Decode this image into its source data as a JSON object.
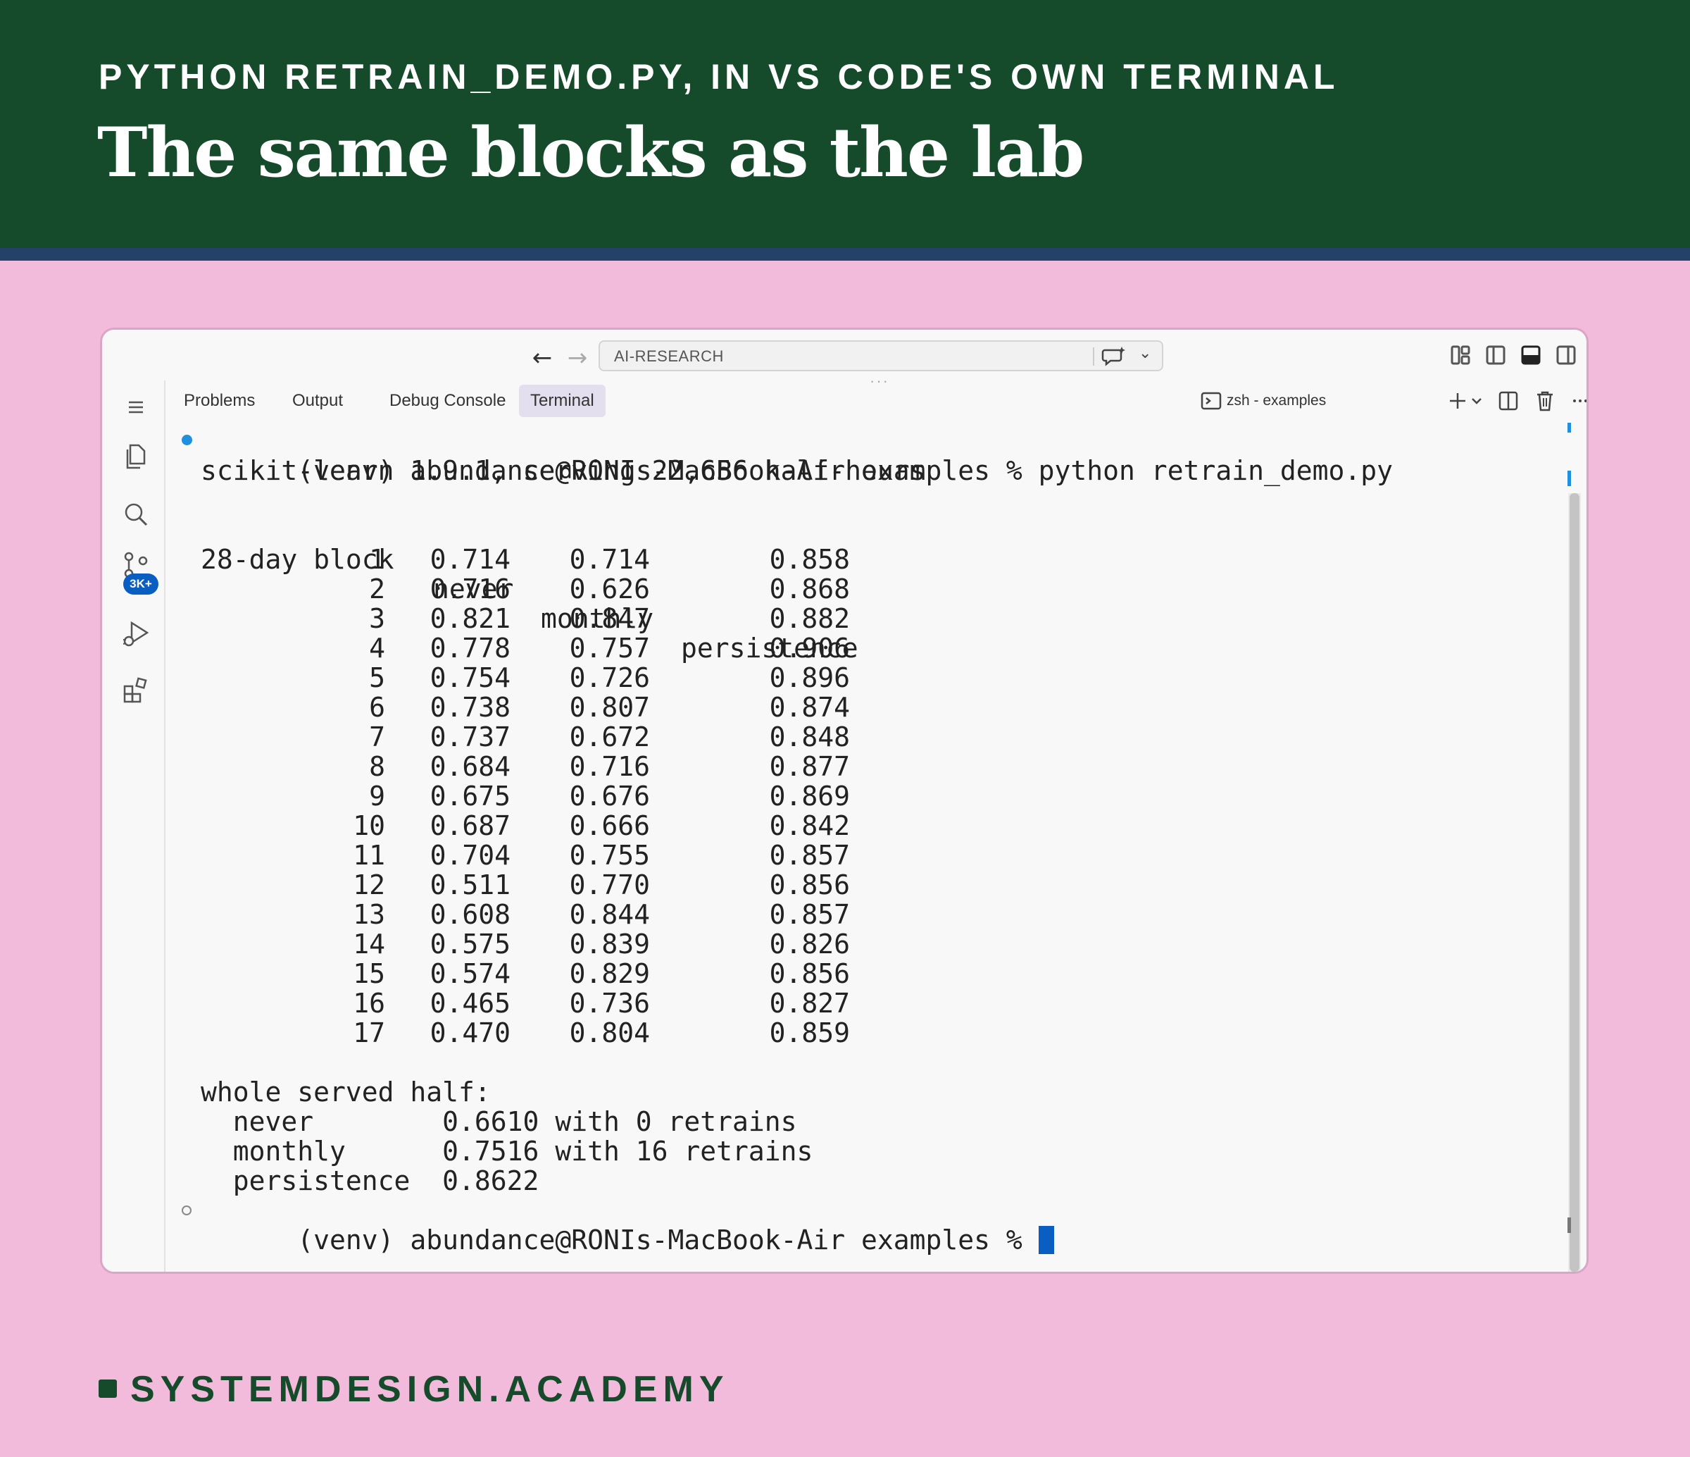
{
  "header": {
    "kicker": "PYTHON RETRAIN_DEMO.PY, IN VS CODE'S OWN TERMINAL",
    "title": "The same blocks as the lab"
  },
  "window": {
    "search_text": "AI-RESEARCH",
    "activity_bar": {
      "icons": [
        "menu-icon",
        "explorer-icon",
        "search-icon",
        "source-control-icon",
        "run-debug-icon",
        "extensions-icon"
      ],
      "source_control_badge": "3K+"
    },
    "panel_tabs": {
      "problems": "Problems",
      "output": "Output",
      "debug_console": "Debug Console",
      "terminal": "Terminal",
      "active": "Terminal"
    },
    "terminal_name": "zsh - examples",
    "accent_color": "#0a5ec2"
  },
  "terminal": {
    "command_line": "(venv) abundance@RONIs-MacBook-Air examples % python retrain_demo.py",
    "info_line": "scikit-learn 1.9.1, serving 22,656 half-hours",
    "table_header": {
      "block": "28-day block",
      "never": "never",
      "monthly": "monthly",
      "persistence": "persistence"
    },
    "rows": [
      {
        "block": "1",
        "never": "0.714",
        "monthly": "0.714",
        "persistence": "0.858"
      },
      {
        "block": "2",
        "never": "0.716",
        "monthly": "0.626",
        "persistence": "0.868"
      },
      {
        "block": "3",
        "never": "0.821",
        "monthly": "0.847",
        "persistence": "0.882"
      },
      {
        "block": "4",
        "never": "0.778",
        "monthly": "0.757",
        "persistence": "0.906"
      },
      {
        "block": "5",
        "never": "0.754",
        "monthly": "0.726",
        "persistence": "0.896"
      },
      {
        "block": "6",
        "never": "0.738",
        "monthly": "0.807",
        "persistence": "0.874"
      },
      {
        "block": "7",
        "never": "0.737",
        "monthly": "0.672",
        "persistence": "0.848"
      },
      {
        "block": "8",
        "never": "0.684",
        "monthly": "0.716",
        "persistence": "0.877"
      },
      {
        "block": "9",
        "never": "0.675",
        "monthly": "0.676",
        "persistence": "0.869"
      },
      {
        "block": "10",
        "never": "0.687",
        "monthly": "0.666",
        "persistence": "0.842"
      },
      {
        "block": "11",
        "never": "0.704",
        "monthly": "0.755",
        "persistence": "0.857"
      },
      {
        "block": "12",
        "never": "0.511",
        "monthly": "0.770",
        "persistence": "0.856"
      },
      {
        "block": "13",
        "never": "0.608",
        "monthly": "0.844",
        "persistence": "0.857"
      },
      {
        "block": "14",
        "never": "0.575",
        "monthly": "0.839",
        "persistence": "0.826"
      },
      {
        "block": "15",
        "never": "0.574",
        "monthly": "0.829",
        "persistence": "0.856"
      },
      {
        "block": "16",
        "never": "0.465",
        "monthly": "0.736",
        "persistence": "0.827"
      },
      {
        "block": "17",
        "never": "0.470",
        "monthly": "0.804",
        "persistence": "0.859"
      }
    ],
    "summary_title": "whole served half:",
    "summary_never": "  never        0.6610 with 0 retrains",
    "summary_monthly": "  monthly      0.7516 with 16 retrains",
    "summary_persistence": "  persistence  0.8622",
    "final_prompt": "(venv) abundance@RONIs-MacBook-Air examples % "
  },
  "footer": {
    "brand": "SYSTEMDESIGN.ACADEMY"
  }
}
